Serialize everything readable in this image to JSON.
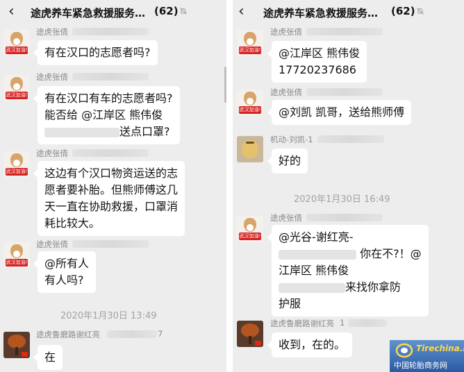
{
  "group": {
    "title": "途虎养车紧急救援服务…",
    "member_count": "(62)",
    "back_icon": "chevron-left-icon",
    "mute_icon": "bell-off-icon",
    "avatar_tag": "武汉加油!"
  },
  "left": {
    "messages": [
      {
        "sender": "途虎张倩",
        "lines": [
          "有在汉口的志愿者吗?"
        ]
      },
      {
        "sender": "途虎张倩",
        "lines": [
          "有在汉口有车的志愿者吗?",
          "能否给 @江岸区 熊伟俊",
          "送点口罩?"
        ]
      },
      {
        "sender": "途虎张倩",
        "lines": [
          "这边有个汉口物资运送的志",
          "愿者要补胎。但熊师傅这几",
          "天一直在协助救援，口罩消",
          "耗比较大。"
        ]
      },
      {
        "sender": "途虎张倩",
        "lines": [
          "@所有人",
          "有人吗?"
        ]
      },
      {
        "sender": "途虎鲁磨路谢红亮",
        "sender_suffix": "7",
        "lines": [
          "在"
        ]
      }
    ],
    "timestamp": "2020年1月30日 13:49"
  },
  "right": {
    "messages": [
      {
        "sender": "途虎张倩",
        "lines": [
          "@江岸区 熊伟俊",
          "17720237686"
        ]
      },
      {
        "sender": "途虎张倩",
        "lines": [
          "@刘凯 凯哥，送给熊师傅"
        ]
      },
      {
        "sender": "机动-刘凯-1",
        "lines": [
          "好的"
        ]
      },
      {
        "sender": "途虎张倩",
        "lines": [
          "@光谷-谢红亮-",
          "你在不?！@",
          "江岸区 熊伟俊",
          "来找你拿防",
          "护服"
        ]
      },
      {
        "sender": "途虎鲁磨路谢红亮",
        "sender_suffix": "1",
        "lines": [
          "收到，在的。"
        ]
      }
    ],
    "timestamp": "2020年1月30日 16:49"
  },
  "watermark": {
    "brand": "Tirechina.net",
    "subtitle": "中国轮胎商务网"
  }
}
